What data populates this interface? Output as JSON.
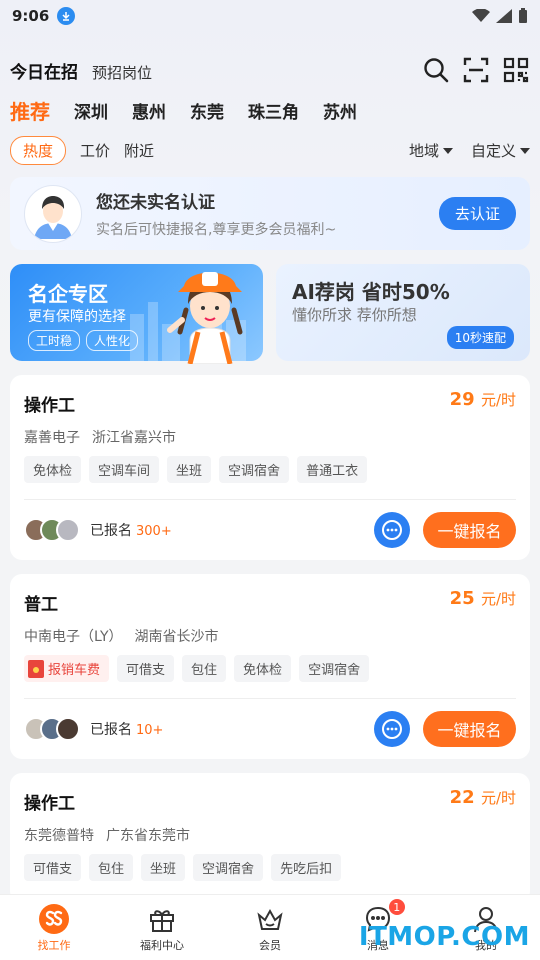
{
  "status_bar": {
    "time": "9:06"
  },
  "top_tabs": {
    "today": "今日在招",
    "pre": "预招岗位"
  },
  "cities": [
    "推荐",
    "深圳",
    "惠州",
    "东莞",
    "珠三角",
    "苏州"
  ],
  "filters": {
    "hot": "热度",
    "wage": "工价",
    "nearby": "附近",
    "region": "地域",
    "custom": "自定义"
  },
  "verify": {
    "title": "您还未实名认证",
    "subtitle": "实名后可快捷报名,尊享更多会员福利~",
    "button": "去认证"
  },
  "promo_left": {
    "title": "名企专区",
    "subtitle": "更有保障的选择",
    "tags": [
      "工时稳",
      "人性化"
    ]
  },
  "promo_right": {
    "title": "AI荐岗 省时50%",
    "subtitle": "懂你所求 荐你所想",
    "badge": "10秒速配"
  },
  "jobs": [
    {
      "title": "操作工",
      "pay": "29",
      "unit": "元/时",
      "company": "嘉善电子",
      "location": "浙江省嘉兴市",
      "tags": [
        "免体检",
        "空调车间",
        "坐班",
        "空调宿舍",
        "普通工衣"
      ],
      "signed_label": "已报名",
      "signed_count": "300+",
      "apply": "一键报名"
    },
    {
      "title": "普工",
      "pay": "25",
      "unit": "元/时",
      "company": "中南电子（LY）",
      "location": "湖南省长沙市",
      "special_tag": "报销车费",
      "tags": [
        "可借支",
        "包住",
        "免体检",
        "空调宿舍"
      ],
      "signed_label": "已报名",
      "signed_count": "10+",
      "apply": "一键报名"
    },
    {
      "title": "操作工",
      "pay": "22",
      "unit": "元/时",
      "company": "东莞德普特",
      "location": "广东省东莞市",
      "tags": [
        "可借支",
        "包住",
        "坐班",
        "空调宿舍",
        "先吃后扣"
      ]
    }
  ],
  "bottom_nav": [
    {
      "label": "找工作",
      "icon": "brand-logo-icon"
    },
    {
      "label": "福利中心",
      "icon": "gift-icon"
    },
    {
      "label": "会员",
      "icon": "crown-icon"
    },
    {
      "label": "消息",
      "icon": "message-icon",
      "badge": "1"
    },
    {
      "label": "我的",
      "icon": "user-icon"
    }
  ],
  "watermark": "ITMOP.COM",
  "colors": {
    "accent": "#ff6a14",
    "primary_blue": "#2b7ff2",
    "pay": "#ff7a17"
  }
}
